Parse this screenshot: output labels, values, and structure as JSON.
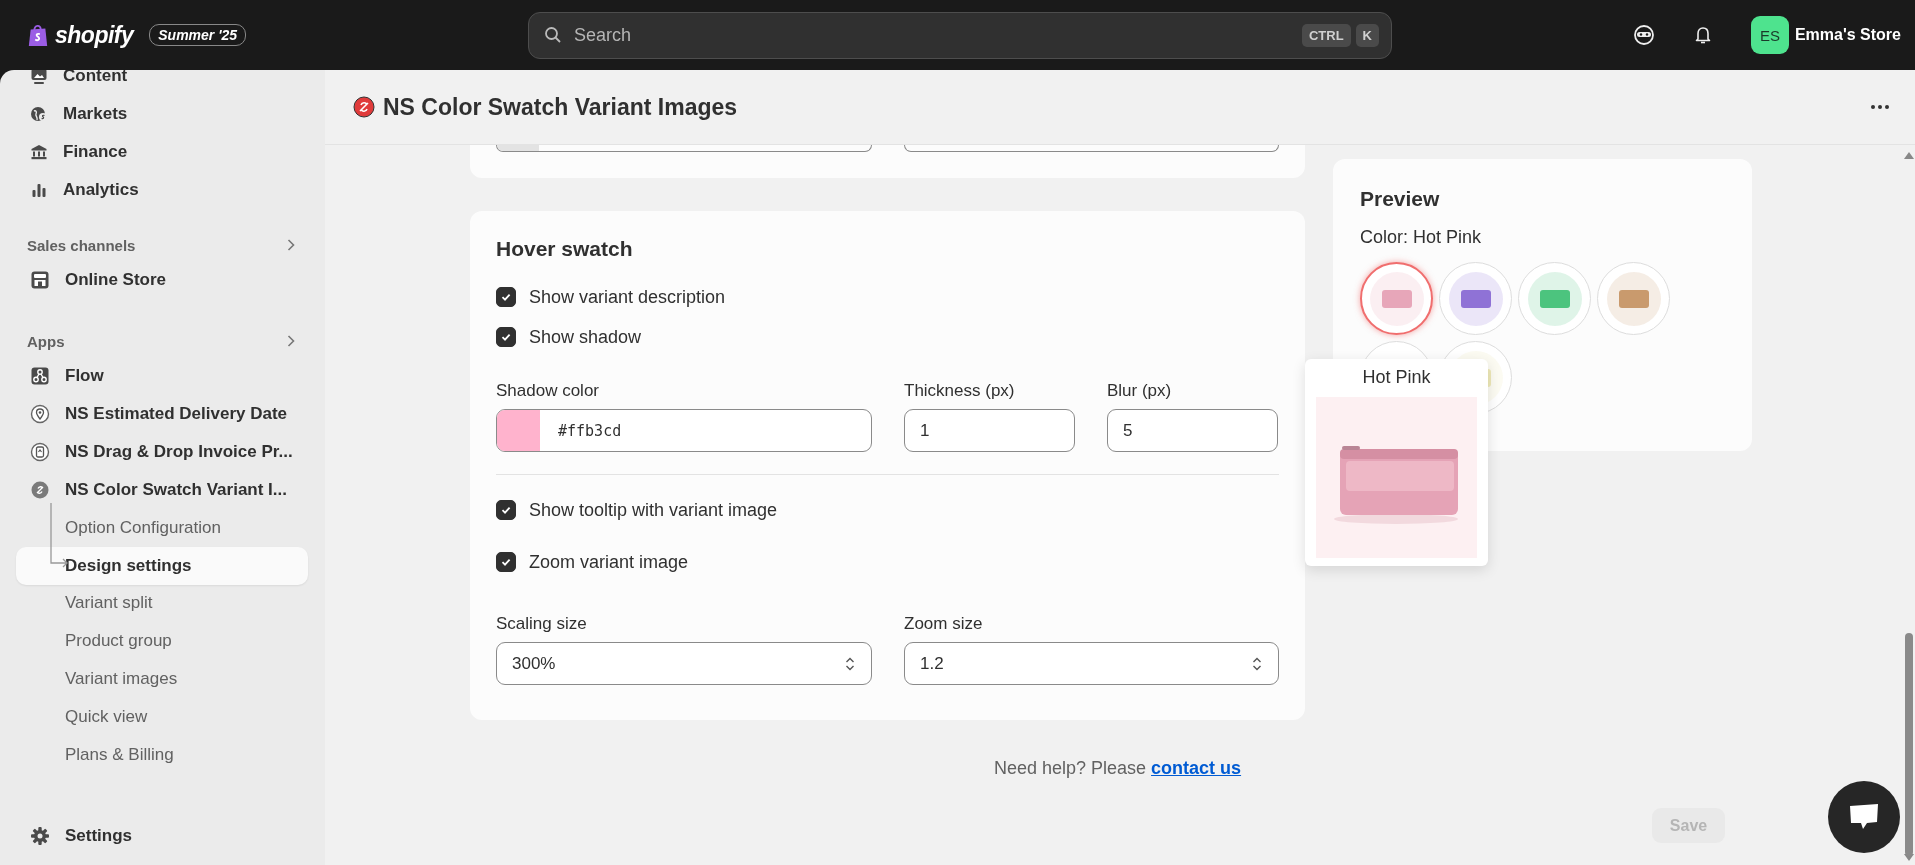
{
  "topbar": {
    "brand": "shopify",
    "badge": "Summer '25",
    "search": {
      "placeholder": "Search",
      "keys": [
        "CTRL",
        "K"
      ]
    },
    "store": {
      "initials": "ES",
      "name": "Emma's Store"
    }
  },
  "sidebar": {
    "top_items": [
      {
        "label": "Content",
        "selected": false
      },
      {
        "label": "Markets",
        "selected": false
      },
      {
        "label": "Finance",
        "selected": false
      },
      {
        "label": "Analytics",
        "selected": false
      }
    ],
    "sections": [
      {
        "title": "Sales channels",
        "items": [
          {
            "label": "Online Store",
            "selected": false
          }
        ]
      },
      {
        "title": "Apps",
        "items": [
          {
            "label": "Flow",
            "selected": false
          },
          {
            "label": "NS Estimated Delivery Date",
            "selected": false
          },
          {
            "label": "NS Drag & Drop Invoice Pr...",
            "selected": false
          },
          {
            "label": "NS Color Swatch Variant I...",
            "selected": false,
            "expanded": true,
            "children": [
              {
                "label": "Option Configuration",
                "selected": false
              },
              {
                "label": "Design settings",
                "selected": true
              },
              {
                "label": "Variant split",
                "selected": false
              },
              {
                "label": "Product group",
                "selected": false
              },
              {
                "label": "Variant images",
                "selected": false
              },
              {
                "label": "Quick view",
                "selected": false
              },
              {
                "label": "Plans & Billing",
                "selected": false
              }
            ]
          }
        ]
      }
    ],
    "bottom_item": {
      "label": "Settings",
      "selected": false
    }
  },
  "page": {
    "title": "NS Color Swatch Variant Images"
  },
  "hover_swatch": {
    "title": "Hover swatch",
    "options": [
      {
        "label": "Show variant description",
        "checked": true
      },
      {
        "label": "Show shadow",
        "checked": true
      }
    ],
    "shadow_color": {
      "label": "Shadow color",
      "value": "#ffb3cd"
    },
    "thickness": {
      "label": "Thickness (px)",
      "value": "1"
    },
    "blur": {
      "label": "Blur (px)",
      "value": "5"
    },
    "tooltip_options": [
      {
        "label": "Show tooltip with variant image",
        "checked": true
      },
      {
        "label": "Zoom variant image",
        "checked": true
      }
    ],
    "scaling": {
      "label": "Scaling size",
      "value": "300%"
    },
    "zoom": {
      "label": "Zoom size",
      "value": "1.2"
    }
  },
  "help": {
    "text": "Need help? Please ",
    "link": "contact us"
  },
  "save_button": {
    "label": "Save",
    "disabled": true
  },
  "preview": {
    "title": "Preview",
    "color_label": "Color: Hot Pink",
    "swatches": [
      {
        "color": "#e7a6b9",
        "selected": true
      },
      {
        "color": "#8f72d6",
        "selected": false
      },
      {
        "color": "#4cc47e",
        "selected": false
      },
      {
        "color": "#c99a6d",
        "selected": false
      },
      {
        "selected": false
      },
      {
        "color": "#efe9b8",
        "selected": false
      }
    ],
    "tooltip": {
      "label": "Hot Pink"
    }
  }
}
